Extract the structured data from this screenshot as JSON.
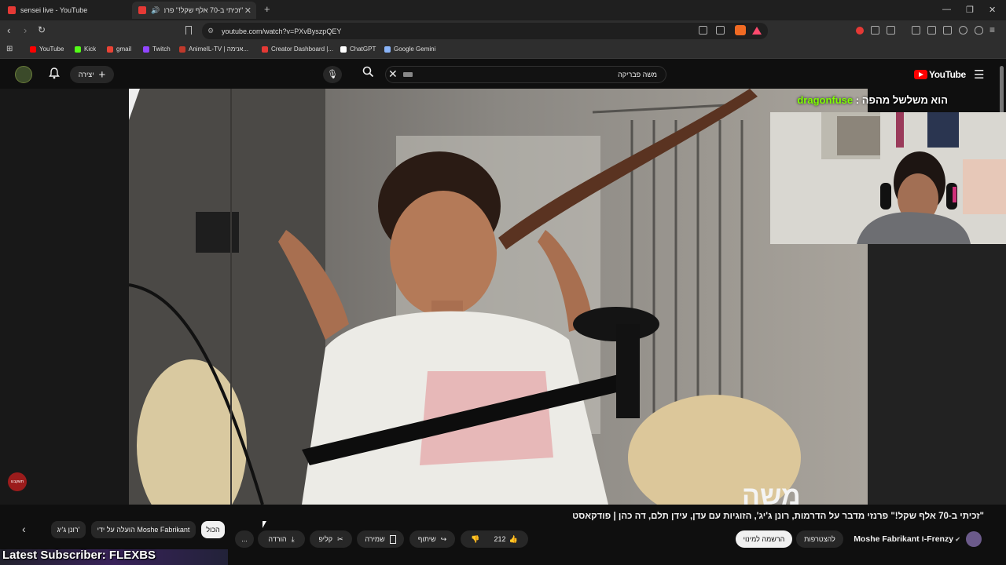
{
  "browser": {
    "tabs": [
      {
        "title": "sensei live - YouTube"
      },
      {
        "title": "\"זכיתי ב-70 אלף שקל!\" פרנזי"
      }
    ],
    "url": "youtube.com/watch?v=PXvByszpQEY",
    "bookmarks": [
      "YouTube",
      "Kick",
      "gmail",
      "Twitch",
      "AnimeIL-TV | אנימה...",
      "Creator Dashboard |...",
      "ChatGPT",
      "Google Gemini"
    ],
    "bookmark_colors": [
      "#ff0000",
      "#53fc18",
      "#ea4335",
      "#9146ff",
      "#c0392b",
      "#e53935",
      "#ffffff",
      "#8ab4f8"
    ]
  },
  "youtube": {
    "logo": "YouTube",
    "create_label": "יצירה",
    "search_value": "משה פבריקה",
    "icons": {
      "mic": "mic-icon",
      "search": "search-icon",
      "bell": "bell-icon",
      "menu": "menu-icon"
    }
  },
  "stream": {
    "overlay_name": "dragonfuse",
    "overlay_sep": " : ",
    "overlay_msg": "הוא משלשל מהפה",
    "live_badge": "תשקבגו",
    "latest_subscriber": "Latest Subscriber: FLEXBS",
    "video_caption": "משה"
  },
  "video": {
    "title": "\"זכיתי ב-70 אלף שקל!\" פרנזי מדבר על הדרמות, רונן ג'יג', הזוגיות עם עדן, עידן תלם, דה כהן | פודקאסט",
    "channel": "Frenzy-ו Moshe Fabrikant",
    "join_label": "להצטרפות",
    "subscribe_label": "הרשמה למינוי",
    "likes": "212",
    "share_label": "שיתוף",
    "save_label": "שמירה",
    "clip_label": "קליפ",
    "download_label": "הורדה",
    "more_label": "..."
  },
  "chips": {
    "all": "הכול",
    "uploaded_by": "הועלה על ידי Moshe Fabrikant",
    "ronen": "רונן ג'יג'"
  }
}
